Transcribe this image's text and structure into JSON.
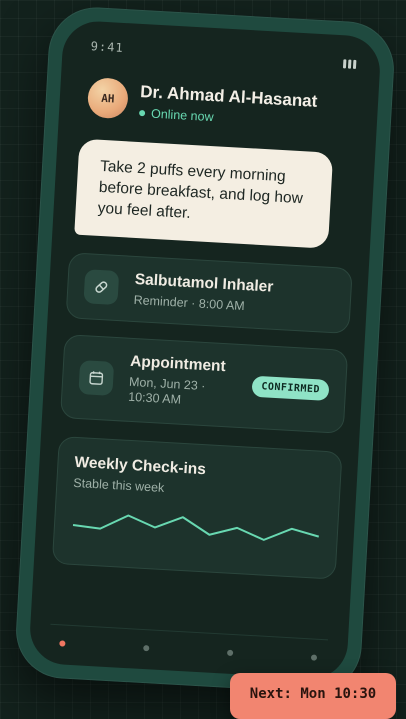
{
  "status_bar": {
    "time": "9:41",
    "battery_icon": "battery-icon"
  },
  "header": {
    "avatar_initials": "AH",
    "doctor_name": "Dr. Ahmad Al-Hasanat",
    "status": "Online now"
  },
  "message": {
    "text": "Take 2 puffs every morning before breakfast, and log how you feel after."
  },
  "medication_card": {
    "icon": "pill-icon",
    "title": "Salbutamol Inhaler",
    "subtitle": "Reminder · 8:00 AM"
  },
  "appointment_card": {
    "icon": "calendar-icon",
    "title": "Appointment",
    "subtitle": "Mon, Jun 23 · 10:30 AM",
    "badge": "CONFIRMED"
  },
  "checkin_card": {
    "title": "Weekly Check-ins",
    "subtitle": "Stable this week"
  },
  "chart_data": {
    "type": "line",
    "title": "Weekly Check-ins",
    "subtitle": "Stable this week",
    "x": [
      1,
      2,
      3,
      4,
      5,
      6,
      7,
      8,
      9,
      10
    ],
    "values": [
      0.45,
      0.4,
      0.75,
      0.5,
      0.78,
      0.4,
      0.6,
      0.35,
      0.65,
      0.5
    ],
    "ylim": [
      0,
      1
    ],
    "grid": false,
    "color": "#68d8b1"
  },
  "bottom_nav": {
    "count": 4,
    "active_index": 0
  },
  "next_pill": {
    "label": "Next: Mon 10:30"
  },
  "colors": {
    "accent": "#68d8b1",
    "badge": "#8fe3c6",
    "highlight": "#f28570",
    "bubble": "#f4eee2"
  }
}
